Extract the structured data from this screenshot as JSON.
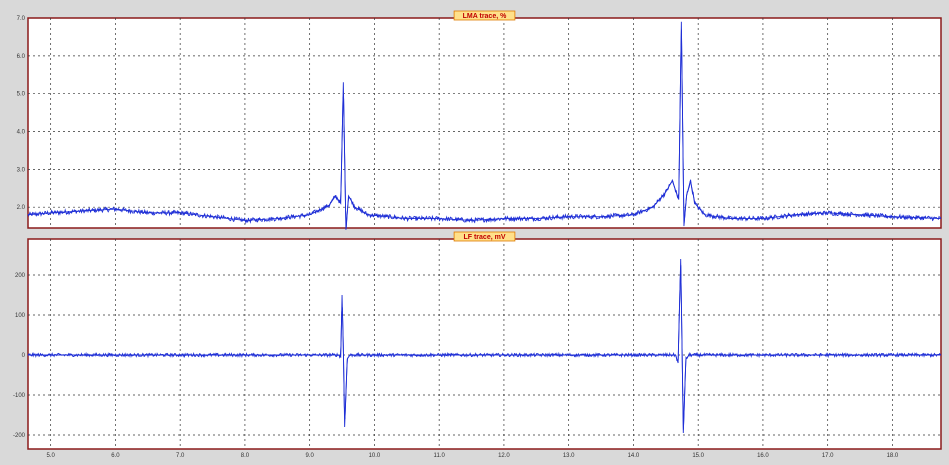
{
  "chart_data": [
    {
      "type": "line",
      "title": "LMA trace, %",
      "xlabel": "",
      "ylabel": "",
      "xlim": [
        4.65,
        18.75
      ],
      "ylim": [
        1.45,
        7.0
      ],
      "x_ticks": [
        5.0,
        6.0,
        7.0,
        8.0,
        9.0,
        10.0,
        11.0,
        12.0,
        13.0,
        14.0,
        15.0,
        16.0,
        17.0,
        18.0
      ],
      "y_ticks": [
        2.0,
        3.0,
        4.0,
        5.0,
        6.0,
        7.0
      ],
      "y_tick_labels": [
        "2.0",
        "3.0",
        "4.0",
        "5.0",
        "6.0",
        "7.0"
      ],
      "grid": true,
      "series": [
        {
          "color": "#1f2fd6",
          "baseline": 1.75,
          "noise": 0.06,
          "points": [
            [
              4.65,
              1.8
            ],
            [
              5.0,
              1.85
            ],
            [
              5.5,
              1.9
            ],
            [
              6.0,
              1.95
            ],
            [
              6.5,
              1.85
            ],
            [
              7.0,
              1.85
            ],
            [
              7.5,
              1.75
            ],
            [
              8.0,
              1.65
            ],
            [
              8.5,
              1.7
            ],
            [
              9.0,
              1.8
            ],
            [
              9.3,
              2.05
            ],
            [
              9.4,
              2.3
            ],
            [
              9.48,
              2.1
            ],
            [
              9.52,
              5.3
            ],
            [
              9.56,
              1.4
            ],
            [
              9.6,
              2.3
            ],
            [
              9.7,
              2.0
            ],
            [
              9.9,
              1.8
            ],
            [
              10.5,
              1.7
            ],
            [
              11.0,
              1.7
            ],
            [
              11.5,
              1.65
            ],
            [
              12.0,
              1.7
            ],
            [
              12.5,
              1.7
            ],
            [
              13.0,
              1.75
            ],
            [
              13.5,
              1.75
            ],
            [
              14.0,
              1.8
            ],
            [
              14.3,
              2.0
            ],
            [
              14.5,
              2.4
            ],
            [
              14.6,
              2.7
            ],
            [
              14.7,
              2.2
            ],
            [
              14.74,
              6.9
            ],
            [
              14.78,
              1.5
            ],
            [
              14.82,
              2.3
            ],
            [
              14.88,
              2.7
            ],
            [
              14.95,
              2.1
            ],
            [
              15.1,
              1.8
            ],
            [
              15.5,
              1.7
            ],
            [
              16.0,
              1.7
            ],
            [
              16.5,
              1.8
            ],
            [
              17.0,
              1.85
            ],
            [
              17.5,
              1.8
            ],
            [
              18.0,
              1.75
            ],
            [
              18.75,
              1.7
            ]
          ]
        }
      ]
    },
    {
      "type": "line",
      "title": "LF trace, mV",
      "xlabel": "",
      "ylabel": "",
      "xlim": [
        4.65,
        18.75
      ],
      "ylim": [
        -235,
        290
      ],
      "x_ticks": [
        5.0,
        6.0,
        7.0,
        8.0,
        9.0,
        10.0,
        11.0,
        12.0,
        13.0,
        14.0,
        15.0,
        16.0,
        17.0,
        18.0
      ],
      "x_tick_labels": [
        "5.0",
        "6.0",
        "7.0",
        "8.0",
        "9.0",
        "10.0",
        "11.0",
        "12.0",
        "13.0",
        "14.0",
        "15.0",
        "16.0",
        "17.0",
        "18.0"
      ],
      "y_ticks": [
        -200,
        -100,
        0,
        100,
        200
      ],
      "y_tick_labels": [
        "-200",
        "-100",
        "0",
        "100",
        "200"
      ],
      "grid": true,
      "series": [
        {
          "color": "#1f2fd6",
          "baseline": 0,
          "noise": 4,
          "points": [
            [
              4.65,
              0
            ],
            [
              9.45,
              0
            ],
            [
              9.48,
              -5
            ],
            [
              9.5,
              150
            ],
            [
              9.52,
              20
            ],
            [
              9.54,
              -180
            ],
            [
              9.58,
              -10
            ],
            [
              9.62,
              0
            ],
            [
              14.65,
              0
            ],
            [
              14.69,
              -20
            ],
            [
              14.73,
              240
            ],
            [
              14.75,
              30
            ],
            [
              14.77,
              -195
            ],
            [
              14.81,
              -10
            ],
            [
              14.86,
              0
            ],
            [
              18.75,
              0
            ]
          ]
        }
      ]
    }
  ]
}
